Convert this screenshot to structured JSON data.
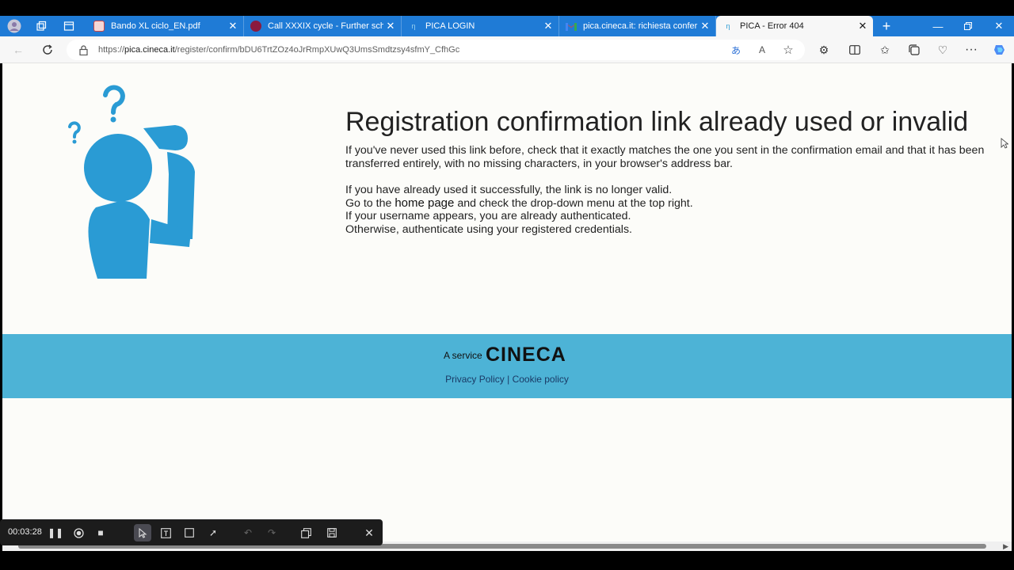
{
  "tabs": [
    {
      "title": "Bando XL ciclo_EN.pdf",
      "favicon": "pdf-icon",
      "active": false
    },
    {
      "title": "Call XXXIX cycle - Further schola",
      "favicon": "site-icon",
      "active": false
    },
    {
      "title": "PICA LOGIN",
      "favicon": "pica-icon",
      "active": false
    },
    {
      "title": "pica.cineca.it: richiesta conferma",
      "favicon": "gmail-icon",
      "active": false
    },
    {
      "title": "PICA - Error 404",
      "favicon": "pica-icon",
      "active": true
    }
  ],
  "address": {
    "scheme": "https://",
    "host": "pica.cineca.it",
    "path": "/register/confirm/bDU6TrtZOz4oJrRmpXUwQ3UmsSmdtzsy4sfmY_CfhGc"
  },
  "page": {
    "headline": "Registration confirmation link already used or invalid",
    "para1": "If you've never used this link before, check that it exactly matches the one you sent in the confirmation email and that it has been transferred entirely, with no missing characters, in your browser's address bar.",
    "para2_line1": "If you have already used it successfully, the link is no longer valid.",
    "para2_line2_prefix": "Go to the ",
    "para2_link": "home page",
    "para2_line2_suffix": " and check the drop-down menu at the top right.",
    "para2_line3": "If your username appears, you are already authenticated.",
    "para2_line4": "Otherwise, authenticate using your registered credentials."
  },
  "footer": {
    "service_label": "A service",
    "logo_text": "CINECA",
    "privacy_link": "Privacy Policy",
    "separator": "|",
    "cookie_link": "Cookie policy"
  },
  "recorder": {
    "time": "00:03:28"
  },
  "colors": {
    "tabbar": "#1f7bd6",
    "footer": "#4db3d6",
    "illustration": "#2a9bd4"
  }
}
